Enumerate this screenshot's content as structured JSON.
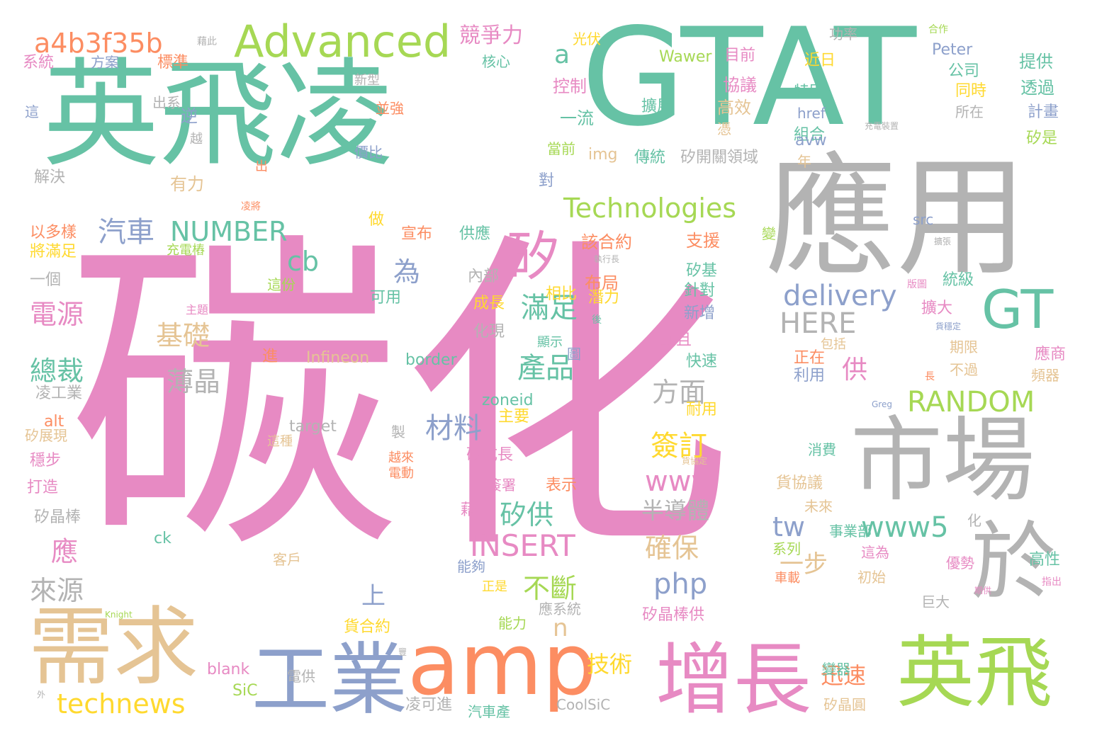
{
  "palette": {
    "teal": "#66c2a5",
    "orange": "#fc8d62",
    "blue": "#8da0cb",
    "pink": "#e78ac3",
    "lime": "#a6d854",
    "yellow": "#ffd92f",
    "tan": "#e5c494",
    "gray": "#b3b3b3",
    "background": "#ffffff"
  },
  "words": [
    {
      "text": "碳化",
      "color": "pink"
    },
    {
      "text": "GTAT",
      "color": "teal"
    },
    {
      "text": "英飛凌",
      "color": "teal"
    },
    {
      "text": "應用",
      "color": "gray"
    },
    {
      "text": "市場",
      "color": "gray"
    },
    {
      "text": "需求",
      "color": "tan"
    },
    {
      "text": "工業",
      "color": "blue"
    },
    {
      "text": "amp",
      "color": "orange"
    },
    {
      "text": "增長",
      "color": "pink"
    },
    {
      "text": "英飛",
      "color": "lime"
    },
    {
      "text": "於",
      "color": "gray"
    },
    {
      "text": "GT",
      "color": "teal"
    },
    {
      "text": "Advanced",
      "color": "lime"
    },
    {
      "text": "a4b3f35b",
      "color": "orange"
    },
    {
      "text": "矽",
      "color": "pink"
    },
    {
      "text": "Technologies",
      "color": "lime"
    },
    {
      "text": "NUMBER",
      "color": "teal"
    },
    {
      "text": "汽車",
      "color": "blue"
    },
    {
      "text": "競爭力",
      "color": "pink"
    },
    {
      "text": "RANDOM",
      "color": "lime"
    },
    {
      "text": "delivery",
      "color": "blue"
    },
    {
      "text": "HERE",
      "color": "gray"
    },
    {
      "text": "technews",
      "color": "yellow"
    },
    {
      "text": "INSERT",
      "color": "pink"
    },
    {
      "text": "php",
      "color": "blue"
    },
    {
      "text": "www5",
      "color": "teal"
    },
    {
      "text": "www",
      "color": "pink"
    },
    {
      "text": "cb",
      "color": "teal"
    },
    {
      "text": "a",
      "color": "teal"
    },
    {
      "text": "n",
      "color": "tan"
    },
    {
      "text": "tw",
      "color": "blue"
    },
    {
      "text": "滿足",
      "color": "teal"
    },
    {
      "text": "產品",
      "color": "teal"
    },
    {
      "text": "基礎",
      "color": "tan"
    },
    {
      "text": "電源",
      "color": "pink"
    },
    {
      "text": "總裁",
      "color": "teal"
    },
    {
      "text": "薄晶",
      "color": "gray"
    },
    {
      "text": "方面",
      "color": "gray"
    },
    {
      "text": "材料",
      "color": "blue"
    },
    {
      "text": "簽訂",
      "color": "yellow"
    },
    {
      "text": "矽供",
      "color": "teal"
    },
    {
      "text": "確保",
      "color": "tan"
    },
    {
      "text": "不斷",
      "color": "lime"
    },
    {
      "text": "應",
      "color": "pink"
    },
    {
      "text": "來源",
      "color": "gray"
    },
    {
      "text": "為",
      "color": "blue"
    },
    {
      "text": "供",
      "color": "pink"
    },
    {
      "text": "技術",
      "color": "yellow"
    },
    {
      "text": "迅速",
      "color": "orange"
    },
    {
      "text": "一步",
      "color": "tan"
    },
    {
      "text": "半導體",
      "color": "gray"
    },
    {
      "text": "上",
      "color": "blue"
    },
    {
      "text": "系統",
      "color": "pink"
    },
    {
      "text": "方案",
      "color": "blue"
    },
    {
      "text": "標準",
      "color": "orange"
    },
    {
      "text": "藉此",
      "color": "gray"
    },
    {
      "text": "光伏",
      "color": "yellow"
    },
    {
      "text": "核心",
      "color": "teal"
    },
    {
      "text": "功率",
      "color": "gray"
    },
    {
      "text": "合作",
      "color": "lime"
    },
    {
      "text": "Wawer",
      "color": "lime"
    },
    {
      "text": "目前",
      "color": "pink"
    },
    {
      "text": "Peter",
      "color": "blue"
    },
    {
      "text": "提供",
      "color": "teal"
    },
    {
      "text": "近日",
      "color": "yellow"
    },
    {
      "text": "公司",
      "color": "teal"
    },
    {
      "text": "新型",
      "color": "gray"
    },
    {
      "text": "控制",
      "color": "pink"
    },
    {
      "text": "協議",
      "color": "pink"
    },
    {
      "text": "同時",
      "color": "yellow"
    },
    {
      "text": "透過",
      "color": "teal"
    },
    {
      "text": "出系",
      "color": "gray"
    },
    {
      "text": "特別",
      "color": "teal"
    },
    {
      "text": "並強",
      "color": "orange"
    },
    {
      "text": "擴展",
      "color": "teal"
    },
    {
      "text": "高效",
      "color": "tan"
    },
    {
      "text": "所在",
      "color": "gray"
    },
    {
      "text": "計畫",
      "color": "blue"
    },
    {
      "text": "這",
      "color": "blue"
    },
    {
      "text": "逆",
      "color": "blue"
    },
    {
      "text": "一流",
      "color": "teal"
    },
    {
      "text": "憑",
      "color": "tan"
    },
    {
      "text": "href",
      "color": "blue"
    },
    {
      "text": "充電裝置",
      "color": "gray"
    },
    {
      "text": "越",
      "color": "gray"
    },
    {
      "text": "價比",
      "color": "blue"
    },
    {
      "text": "組合",
      "color": "teal"
    },
    {
      "text": "avw",
      "color": "blue"
    },
    {
      "text": "矽是",
      "color": "lime"
    },
    {
      "text": "當前",
      "color": "lime"
    },
    {
      "text": "img",
      "color": "tan"
    },
    {
      "text": "傳統",
      "color": "teal"
    },
    {
      "text": "矽開關領域",
      "color": "gray"
    },
    {
      "text": "年",
      "color": "tan"
    },
    {
      "text": "解決",
      "color": "gray"
    },
    {
      "text": "出",
      "color": "orange"
    },
    {
      "text": "有力",
      "color": "tan"
    },
    {
      "text": "對",
      "color": "blue"
    },
    {
      "text": "凌將",
      "color": "orange"
    },
    {
      "text": "src",
      "color": "blue"
    },
    {
      "text": "以多樣",
      "color": "orange"
    },
    {
      "text": "做",
      "color": "yellow"
    },
    {
      "text": "宣布",
      "color": "orange"
    },
    {
      "text": "供應",
      "color": "teal"
    },
    {
      "text": "該合約",
      "color": "orange"
    },
    {
      "text": "支援",
      "color": "orange"
    },
    {
      "text": "變",
      "color": "lime"
    },
    {
      "text": "擴張",
      "color": "gray"
    },
    {
      "text": "將滿足",
      "color": "yellow"
    },
    {
      "text": "充電樁",
      "color": "lime"
    },
    {
      "text": "執行長",
      "color": "gray"
    },
    {
      "text": "一個",
      "color": "gray"
    },
    {
      "text": "內部",
      "color": "gray"
    },
    {
      "text": "布局",
      "color": "orange"
    },
    {
      "text": "矽基",
      "color": "teal"
    },
    {
      "text": "統級",
      "color": "teal"
    },
    {
      "text": "這份",
      "color": "lime"
    },
    {
      "text": "可用",
      "color": "teal"
    },
    {
      "text": "相比",
      "color": "yellow"
    },
    {
      "text": "潛力",
      "color": "yellow"
    },
    {
      "text": "針對",
      "color": "teal"
    },
    {
      "text": "版圖",
      "color": "pink"
    },
    {
      "text": "主題",
      "color": "pink"
    },
    {
      "text": "成長",
      "color": "yellow"
    },
    {
      "text": "新增",
      "color": "blue"
    },
    {
      "text": "擴大",
      "color": "pink"
    },
    {
      "text": "後",
      "color": "teal"
    },
    {
      "text": "貨穩定",
      "color": "blue"
    },
    {
      "text": "化現",
      "color": "gray"
    },
    {
      "text": "顯示",
      "color": "teal"
    },
    {
      "text": "並且",
      "color": "pink"
    },
    {
      "text": "包括",
      "color": "tan"
    },
    {
      "text": "期限",
      "color": "tan"
    },
    {
      "text": "應商",
      "color": "pink"
    },
    {
      "text": "進",
      "color": "orange"
    },
    {
      "text": "Infineon",
      "color": "tan"
    },
    {
      "text": "border",
      "color": "teal"
    },
    {
      "text": "圖",
      "color": "blue"
    },
    {
      "text": "快速",
      "color": "teal"
    },
    {
      "text": "正在",
      "color": "orange"
    },
    {
      "text": "利用",
      "color": "blue"
    },
    {
      "text": "長",
      "color": "orange"
    },
    {
      "text": "不過",
      "color": "tan"
    },
    {
      "text": "頻器",
      "color": "tan"
    },
    {
      "text": "凌工業",
      "color": "gray"
    },
    {
      "text": "zoneid",
      "color": "teal"
    },
    {
      "text": "耐用",
      "color": "yellow"
    },
    {
      "text": "Greg",
      "color": "blue"
    },
    {
      "text": "alt",
      "color": "orange"
    },
    {
      "text": "主要",
      "color": "yellow"
    },
    {
      "text": "矽展現",
      "color": "tan"
    },
    {
      "text": "target",
      "color": "gray"
    },
    {
      "text": "製",
      "color": "gray"
    },
    {
      "text": "這種",
      "color": "tan"
    },
    {
      "text": "矽成長",
      "color": "pink"
    },
    {
      "text": "消費",
      "color": "teal"
    },
    {
      "text": "穩步",
      "color": "pink"
    },
    {
      "text": "越來",
      "color": "orange"
    },
    {
      "text": "貨協定",
      "color": "tan"
    },
    {
      "text": "打造",
      "color": "pink"
    },
    {
      "text": "電動",
      "color": "orange"
    },
    {
      "text": "簽署",
      "color": "pink"
    },
    {
      "text": "表示",
      "color": "orange"
    },
    {
      "text": "貨協議",
      "color": "tan"
    },
    {
      "text": "未來",
      "color": "tan"
    },
    {
      "text": "矽晶棒",
      "color": "gray"
    },
    {
      "text": "藉",
      "color": "pink"
    },
    {
      "text": "化",
      "color": "gray"
    },
    {
      "text": "事業部",
      "color": "teal"
    },
    {
      "text": "ck",
      "color": "teal"
    },
    {
      "text": "這為",
      "color": "pink"
    },
    {
      "text": "系列",
      "color": "lime"
    },
    {
      "text": "客戶",
      "color": "tan"
    },
    {
      "text": "能夠",
      "color": "blue"
    },
    {
      "text": "初始",
      "color": "tan"
    },
    {
      "text": "優勢",
      "color": "pink"
    },
    {
      "text": "高性",
      "color": "teal"
    },
    {
      "text": "正是",
      "color": "yellow"
    },
    {
      "text": "車載",
      "color": "orange"
    },
    {
      "text": "期供",
      "color": "pink"
    },
    {
      "text": "指出",
      "color": "pink"
    },
    {
      "text": "Knight",
      "color": "lime"
    },
    {
      "text": "應系統",
      "color": "gray"
    },
    {
      "text": "巨大",
      "color": "gray"
    },
    {
      "text": "能力",
      "color": "lime"
    },
    {
      "text": "矽晶棒供",
      "color": "pink"
    },
    {
      "text": "貨合約",
      "color": "yellow"
    },
    {
      "text": "豐",
      "color": "gray"
    },
    {
      "text": "blank",
      "color": "pink"
    },
    {
      "text": "電供",
      "color": "gray"
    },
    {
      "text": "變器",
      "color": "teal"
    },
    {
      "text": "外",
      "color": "gray"
    },
    {
      "text": "SiC",
      "color": "lime"
    },
    {
      "text": "CoolSiC",
      "color": "gray"
    },
    {
      "text": "凌可進",
      "color": "gray"
    },
    {
      "text": "汽車產",
      "color": "teal"
    },
    {
      "text": "矽晶圓",
      "color": "tan"
    }
  ]
}
